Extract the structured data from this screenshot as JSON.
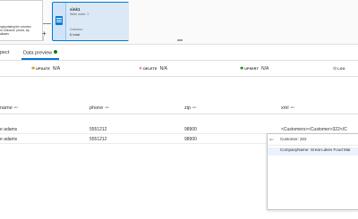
{
  "canvas": {
    "source_node": {
      "description_lines": [
        "ng/updating the columns",
        "m, fullname, phone, zip",
        "aliases"
      ]
    },
    "add_label": "+",
    "sink_node": {
      "title": "sink1",
      "subtitle": "Write order: 1",
      "columns_label": "Columns:",
      "columns_value": "6 total"
    }
  },
  "tabs": [
    {
      "label": "pect"
    },
    {
      "label": "Data preview"
    }
  ],
  "stats": [
    {
      "icon": "update-icon",
      "label": "UPDATE",
      "value": "N/A"
    },
    {
      "icon": "delete-icon",
      "label": "DELETE",
      "value": "N/A"
    },
    {
      "icon": "upsert-icon",
      "label": "UPSERT",
      "value": "N/A"
    },
    {
      "icon": "lookup-icon",
      "label": "LOO",
      "value": ""
    }
  ],
  "table": {
    "columns": [
      {
        "name": "name",
        "type": "abc"
      },
      {
        "name": "phone",
        "type": "abc"
      },
      {
        "name": "zip",
        "type": "abc"
      },
      {
        "name": "xml",
        "type": "abc"
      }
    ],
    "rows": [
      [
        "e adams",
        "5551212",
        "98900",
        "<Customers><Customer>322</C"
      ],
      [
        "e adams",
        "5551212",
        "98900",
        ""
      ]
    ]
  },
  "tooltip": {
    "lines": [
      {
        "type": "abc",
        "text": "Customer: 322"
      },
      {
        "type": "",
        "text": "CompanyName: Great Lakes Food Mar"
      }
    ]
  },
  "colors": {
    "accent": "#0078d4",
    "success_dot": "#107c10",
    "sink_fill": "#cfe4fa",
    "update_icon": "#c19c00",
    "delete_icon": "#d13438",
    "upsert_icon": "#107c10"
  }
}
